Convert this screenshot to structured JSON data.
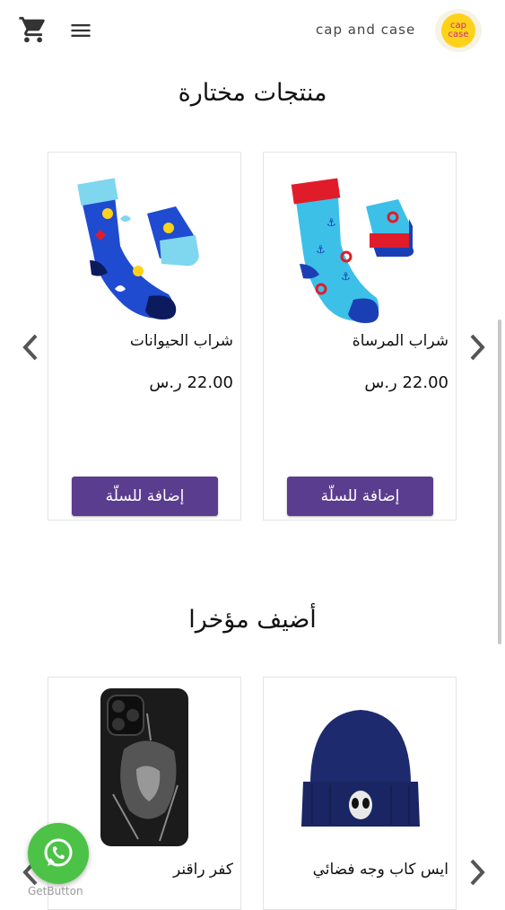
{
  "header": {
    "brand_name": "cap and case",
    "logo_text_top": "cap",
    "logo_text_bottom": "case",
    "cart_icon": "shopping-cart-icon",
    "menu_icon": "hamburger-menu-icon"
  },
  "featured": {
    "title": "منتجات مختارة",
    "products": [
      {
        "name": "شراب المرساة",
        "price": "22.00 ر.س",
        "button": "إضافة للسلّة"
      },
      {
        "name": "شراب الحيوانات",
        "price": "22.00 ر.س",
        "button": "إضافة للسلّة"
      }
    ]
  },
  "recent": {
    "title": "أضيف مؤخرا",
    "products": [
      {
        "name": "ايس كاب وجه فضائي"
      },
      {
        "name": "كفر راقنر"
      }
    ]
  },
  "whatsapp": {
    "label": "GetButton",
    "icon": "whatsapp-icon"
  },
  "colors": {
    "accent": "#5b3d8f",
    "whatsapp": "#4cc247",
    "logo": "#ffd21a"
  }
}
